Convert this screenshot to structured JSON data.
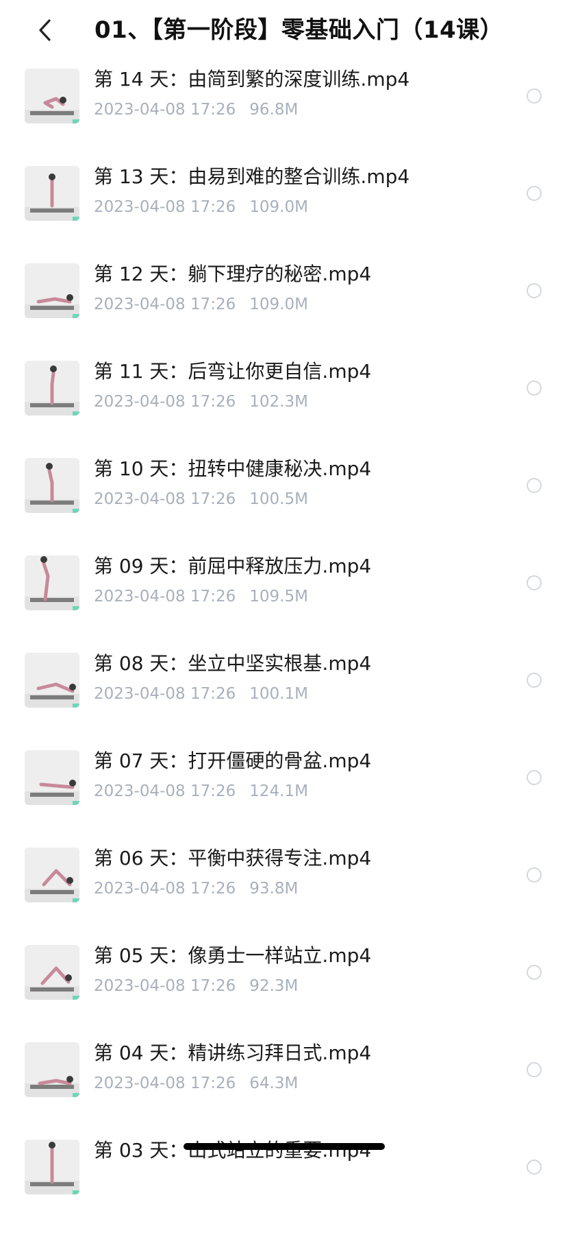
{
  "header": {
    "title": "01、【第一阶段】零基础入门（14课）",
    "back_icon": "chevron-left-icon"
  },
  "files": [
    {
      "name": "第 14 天：由简到繁的深度训练.mp4",
      "date": "2023-04-08 17:26",
      "size": "96.8M",
      "selected": false
    },
    {
      "name": "第 13 天：由易到难的整合训练.mp4",
      "date": "2023-04-08 17:26",
      "size": "109.0M",
      "selected": false
    },
    {
      "name": "第 12 天：躺下理疗的秘密.mp4",
      "date": "2023-04-08 17:26",
      "size": "109.0M",
      "selected": false
    },
    {
      "name": "第 11 天：后弯让你更自信.mp4",
      "date": "2023-04-08 17:26",
      "size": "102.3M",
      "selected": false
    },
    {
      "name": "第 10 天：扭转中健康秘决.mp4",
      "date": "2023-04-08 17:26",
      "size": "100.5M",
      "selected": false
    },
    {
      "name": "第 09 天：前屈中释放压力.mp4",
      "date": "2023-04-08 17:26",
      "size": "109.5M",
      "selected": false
    },
    {
      "name": "第 08 天：坐立中坚实根基.mp4",
      "date": "2023-04-08 17:26",
      "size": "100.1M",
      "selected": false
    },
    {
      "name": "第 07 天：打开僵硬的骨盆.mp4",
      "date": "2023-04-08 17:26",
      "size": "124.1M",
      "selected": false
    },
    {
      "name": "第 06 天：平衡中获得专注.mp4",
      "date": "2023-04-08 17:26",
      "size": "93.8M",
      "selected": false
    },
    {
      "name": "第 05 天：像勇士一样站立.mp4",
      "date": "2023-04-08 17:26",
      "size": "92.3M",
      "selected": false
    },
    {
      "name": "第 04 天：精讲练习拜日式.mp4",
      "date": "2023-04-08 17:26",
      "size": "64.3M",
      "selected": false
    },
    {
      "name": "第 03 天：山式站立的重要.mp4",
      "date": "",
      "size": "",
      "selected": false
    }
  ],
  "colors": {
    "title": "#111111",
    "filename": "#1a1a1a",
    "meta": "#a9b0bc",
    "radio_border": "#d4d7dd",
    "thumb_bg": "#e6e6e6",
    "mat_dark": "#5a5a5a",
    "accent_green": "#6fd6b8",
    "home_indicator": "#000000"
  }
}
